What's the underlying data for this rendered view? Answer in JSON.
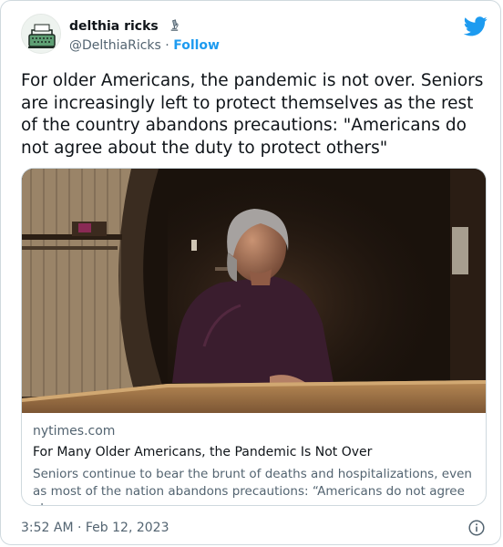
{
  "author": {
    "name": "delthia ricks",
    "name_emoji": "microscope-icon",
    "handle": "@DelthiaRicks",
    "separator": "·",
    "follow_label": "Follow"
  },
  "tweet": {
    "text": "For older Americans, the pandemic is not over. Seniors are increasingly left to protect themselves as the rest of the country abandons precautions: \"Americans do not agree about the duty to protect others\""
  },
  "link_card": {
    "domain": "nytimes.com",
    "title": "For Many Older Americans, the Pandemic Is Not Over",
    "description": "Seniors continue to bear the brunt of deaths and hospitalizations, even as most of the nation abandons precautions: “Americans do not agree abo..."
  },
  "meta": {
    "timestamp": "3:52 AM · Feb 12, 2023"
  },
  "icons": {
    "brand": "twitter-bird-icon",
    "info": "info-icon"
  },
  "colors": {
    "brand_blue": "#1d9bf0",
    "text_primary": "#0f1419",
    "text_secondary": "#536471",
    "border": "#cfd9de"
  }
}
